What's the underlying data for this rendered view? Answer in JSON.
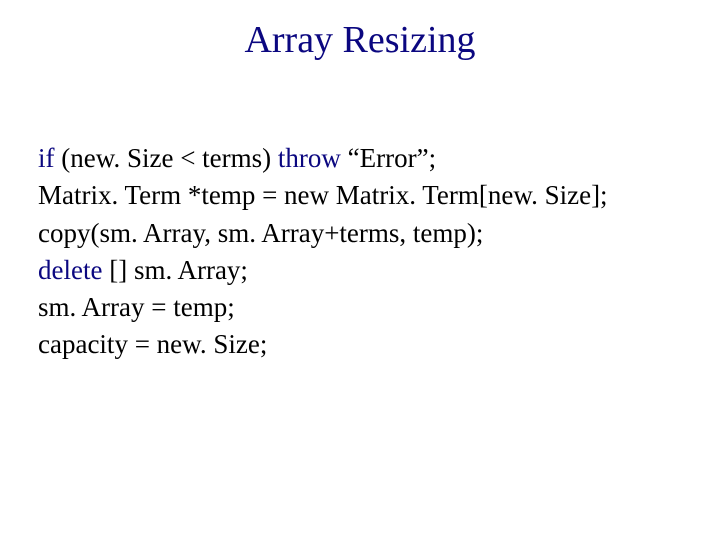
{
  "title": "Array Resizing",
  "code": {
    "l1": {
      "kw1": "if",
      "p1": " (new. Size < terms) ",
      "kw2": "throw",
      "p2": " “Error”;"
    },
    "l2": "Matrix. Term *temp = new Matrix. Term[new. Size];",
    "l3": "copy(sm. Array, sm. Array+terms, temp);",
    "l4": {
      "kw1": "delete",
      "p1": " [] sm. Array;"
    },
    "l5": "sm. Array = temp;",
    "l6": "capacity = new. Size;"
  }
}
